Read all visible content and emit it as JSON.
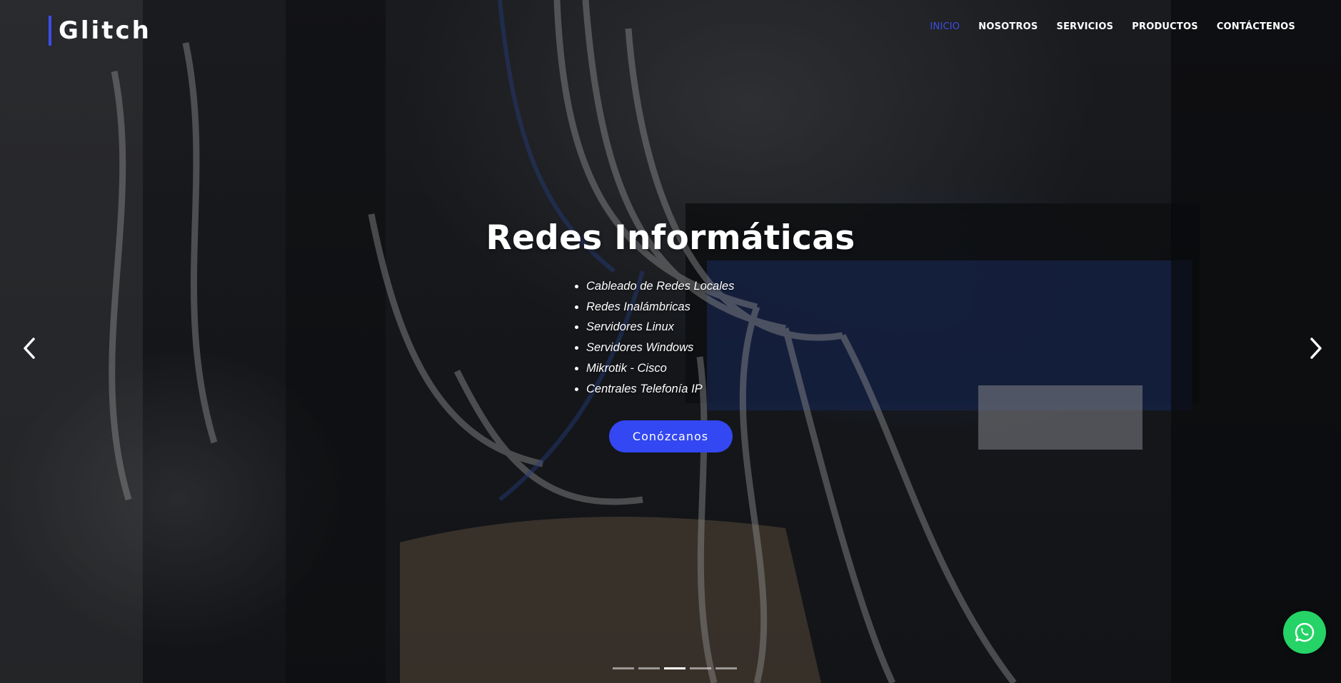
{
  "brand": {
    "logo_text": "Glitch",
    "accent_color": "#3d4de6"
  },
  "nav": {
    "items": [
      {
        "label": "INICIO",
        "active": true
      },
      {
        "label": "NOSOTROS",
        "active": false
      },
      {
        "label": "SERVICIOS",
        "active": false
      },
      {
        "label": "PRODUCTOS",
        "active": false
      },
      {
        "label": "CONTÁCTENOS",
        "active": false
      }
    ]
  },
  "slide": {
    "title": "Redes Informáticas",
    "services": [
      "Cableado de Redes Locales",
      "Redes Inalámbricas",
      "Servidores Linux",
      "Servidores Windows",
      "Mikrotik - Cisco",
      "Centrales Telefonía IP"
    ],
    "cta_label": "Conózcanos",
    "cta_color": "#3347f2"
  },
  "carousel": {
    "prev_icon": "chevron-left-icon",
    "next_icon": "chevron-right-icon",
    "slide_count": 5,
    "active_index": 2
  },
  "whatsapp": {
    "icon": "whatsapp-icon",
    "color": "#25d366"
  }
}
